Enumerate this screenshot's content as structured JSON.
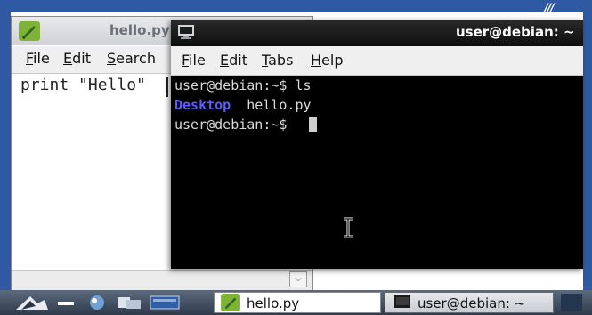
{
  "editor": {
    "title": "hello.py",
    "menu": {
      "file": "ile",
      "file_mn": "F",
      "edit": "dit",
      "edit_mn": "E",
      "search": "earch",
      "search_mn": "S"
    },
    "code_text": "print \"Hello\""
  },
  "terminal": {
    "title": "user@debian: ~",
    "menu": {
      "file": "ile",
      "file_mn": "F",
      "edit": "dit",
      "edit_mn": "E",
      "tabs": "abs",
      "tabs_mn": "T",
      "help": "elp",
      "help_mn": "H"
    },
    "lines": {
      "line1": "user@debian:~$ ls",
      "dir": "Desktop",
      "file": "  hello.py",
      "line3": "user@debian:~$ "
    }
  },
  "taskbar": {
    "task_editor": "hello.py",
    "task_terminal": "user@debian: ~"
  },
  "icons": {
    "editor_app": "leaf-pencil-icon",
    "terminal_app": "terminal-icon",
    "menu_launcher": "start-menu-icon"
  },
  "colors": {
    "desktop_blue": "#2f5aa3",
    "terminal_bg": "#000000",
    "directory_blue": "#5a5cff"
  }
}
